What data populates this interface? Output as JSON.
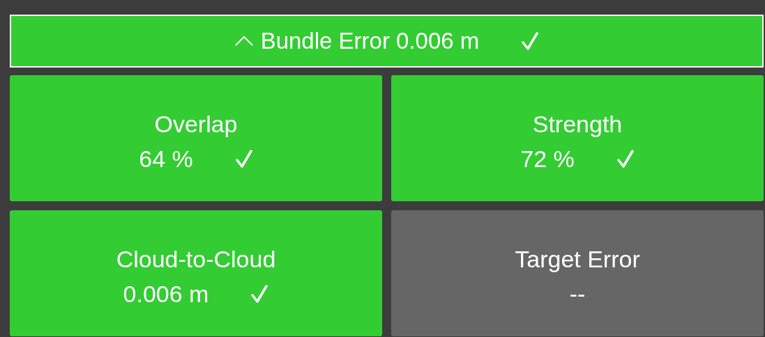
{
  "summary": {
    "label": "Bundle Error 0.006 m",
    "expanded": true,
    "kind": "pass"
  },
  "tiles": [
    {
      "title": "Overlap",
      "value": "64 %",
      "kind": "pass"
    },
    {
      "title": "Strength",
      "value": "72 %",
      "kind": "pass"
    },
    {
      "title": "Cloud-to-Cloud",
      "value": "0.006 m",
      "kind": "pass"
    },
    {
      "title": "Target Error",
      "value": "--",
      "kind": "inactive"
    }
  ]
}
